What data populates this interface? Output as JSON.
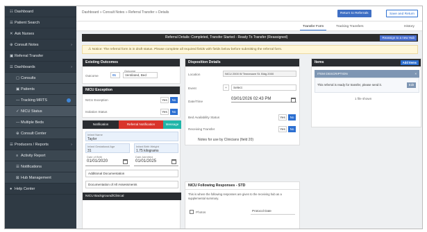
{
  "sidebar": {
    "items": [
      {
        "icon": "☷",
        "label": "Dashboard"
      },
      {
        "icon": "☰",
        "label": "Patient Search"
      },
      {
        "icon": "✕",
        "label": "Ask Nurses"
      },
      {
        "icon": "⊕",
        "label": "Consult Notes",
        "chev": "›"
      },
      {
        "icon": "▣",
        "label": "Referral Transfer"
      },
      {
        "icon": "☰",
        "label": "Dashboards",
        "chev": "›"
      },
      {
        "icon": "▢",
        "label": "Consults"
      },
      {
        "icon": "▣",
        "label": "Patients"
      },
      {
        "icon": "―",
        "label": "Tracking MRTS"
      },
      {
        "icon": "✓",
        "label": "NICU Status"
      },
      {
        "icon": "―",
        "label": "Multiple Beds"
      },
      {
        "icon": "⊕",
        "label": "Consult Center"
      },
      {
        "icon": "☰",
        "label": "Producers / Reports",
        "chev": "›"
      },
      {
        "icon": "≡",
        "label": "Activity Report"
      },
      {
        "icon": "☰",
        "label": "Notifications"
      },
      {
        "icon": "⊠",
        "label": "Hub Management"
      },
      {
        "icon": "●",
        "label": "Help Center"
      }
    ]
  },
  "topbar": {
    "breadcrumb": "Dashboard » Consult Notes » Referral Transfer » Details",
    "btn1": "Return to Referrals",
    "btn2": "Save and Return"
  },
  "tabs": [
    "Transfer Form",
    "Tracking Transfers",
    "History"
  ],
  "banner1": {
    "text": "Referral Details: Completed, Transfer Started - Ready To Transfer (Reassigned)",
    "button": "Reassign to a new Hub"
  },
  "banner2": "Notice: The referral form is in draft status. Please complete all required fields with fields below before submitting the referral form.",
  "existing": {
    "title": "Existing Outcomes",
    "label": "Outcome",
    "code": "01",
    "sublabel": "Outcome",
    "value": "Ventilated, Bed"
  },
  "nicu": {
    "title": "NICU Exception",
    "row1": "NICU Exception",
    "row2": "Isolation Status",
    "yes": "Yes",
    "no": "No"
  },
  "tabs2": [
    "Notification",
    "Referral Notification",
    "Message"
  ],
  "fields": {
    "name_label": "Infant Name",
    "name_value": "Taylor",
    "age_label": "Infant Gestational Age",
    "age_value": "31",
    "weight_label": "Infant Birth Weight",
    "weight_value": "1.75 kilograms",
    "birth_label": "Date of Birth",
    "birth_value": "01/01/2020",
    "admit_label": "Date Admitted",
    "admit_value": "01/01/2025"
  },
  "notes": {
    "line1": "Additional Documentation",
    "line2": "Documentation of All Assessments",
    "footer": "NICU Background/Clinical"
  },
  "disposition": {
    "title": "Disposition Details",
    "r1_label": "Location",
    "r1_value": "NICU 2000 W Tennessee St. Bldg 2000",
    "r2_label": "Event",
    "r2_value": "Select",
    "r3_label": "Date/Time",
    "r3_value": "03/01/2026 02:43 PM",
    "r4_label": "Bed Availability Status",
    "r5_label": "Receiving Transfer",
    "yes": "Yes",
    "no": "No",
    "notes": "Notes for use by Clinicians (field 20)"
  },
  "following": {
    "title": "NICU Following Responses - STD",
    "text": "This is where the following responses are given to the receiving hub as a supplemental summary.",
    "chk": "Photos",
    "input": "Protocol Date"
  },
  "items": {
    "title": "Items",
    "btn": "Add Items",
    "head": "ITEM DESCRIPTION",
    "close": "×",
    "line": "This referral is ready for transfer, please send it.",
    "edit": "Edit",
    "link": "1 file shown"
  }
}
